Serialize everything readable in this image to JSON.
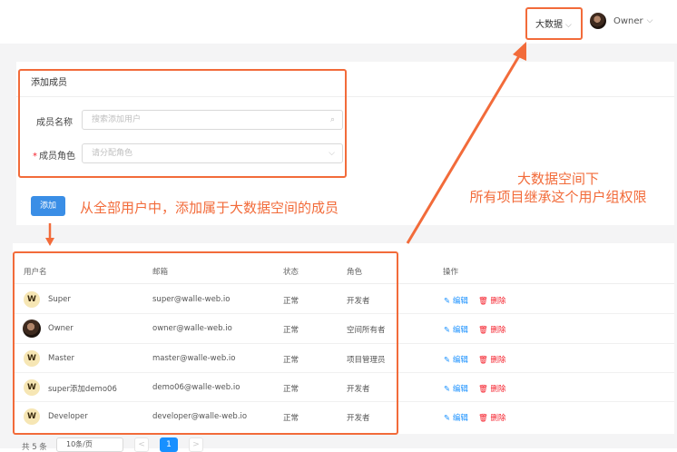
{
  "header": {
    "space_select": "大数据",
    "user_name": "Owner"
  },
  "add_member": {
    "title": "添加成员",
    "name_label": "成员名称",
    "name_placeholder": "搜索添加用户",
    "role_required_mark": "*",
    "role_label": "成员角色",
    "role_placeholder": "请分配角色",
    "add_button": "添加"
  },
  "table": {
    "headers": [
      "用户名",
      "邮箱",
      "状态",
      "角色",
      "操作"
    ],
    "rows": [
      {
        "avatar": "W",
        "username": "Super",
        "email": "super@walle-web.io",
        "status": "正常",
        "role": "开发者"
      },
      {
        "avatar": "photo",
        "username": "Owner",
        "email": "owner@walle-web.io",
        "status": "正常",
        "role": "空间所有者"
      },
      {
        "avatar": "W",
        "username": "Master",
        "email": "master@walle-web.io",
        "status": "正常",
        "role": "项目管理员"
      },
      {
        "avatar": "W",
        "username": "super添加demo06",
        "email": "demo06@walle-web.io",
        "status": "正常",
        "role": "开发者"
      },
      {
        "avatar": "W",
        "username": "Developer",
        "email": "developer@walle-web.io",
        "status": "正常",
        "role": "开发者"
      }
    ],
    "edit_label": "编辑",
    "delete_label": "删除"
  },
  "pagination": {
    "total": "共 5 条",
    "page_size": "10条/页",
    "current_page": "1",
    "prev": "<",
    "next": ">"
  },
  "annotations": {
    "add_note": "从全部用户中，添加属于大数据空间的成员",
    "space_note_line1": "大数据空间下",
    "space_note_line2": "所有项目继承这个用户组权限"
  },
  "colors": {
    "annotation": "#f26b3a",
    "primary": "#1890ff",
    "danger": "#f5222d"
  },
  "icons": {
    "chevron": "chevron-down-icon",
    "search": "search-icon",
    "edit": "edit-icon",
    "delete": "trash-icon"
  }
}
